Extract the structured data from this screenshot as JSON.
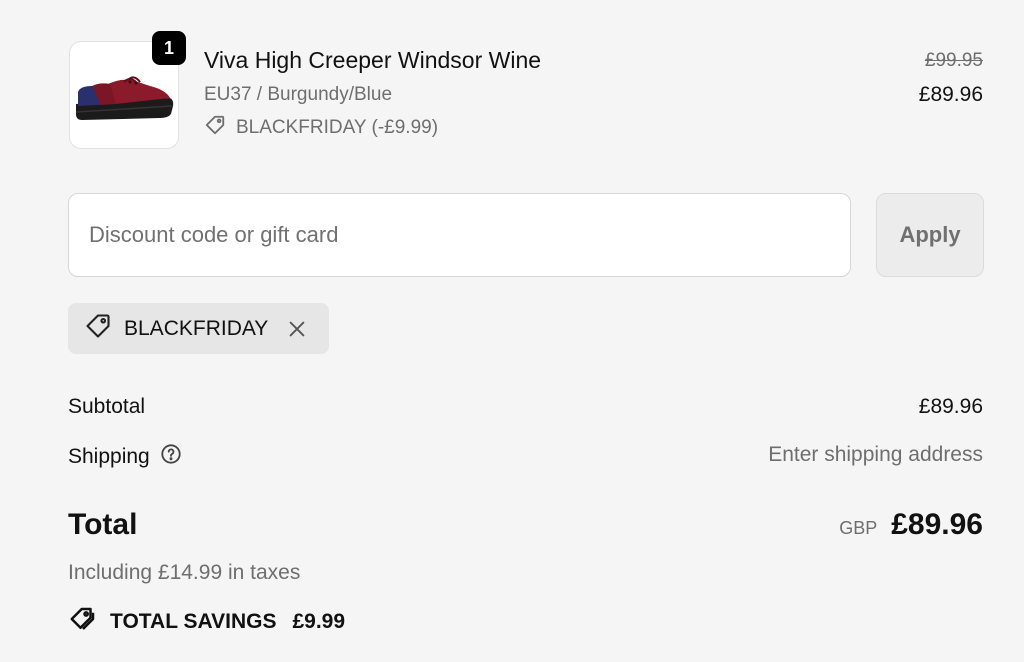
{
  "line_item": {
    "quantity": "1",
    "name": "Viva High Creeper Windsor Wine",
    "variant": "EU37 / Burgundy/Blue",
    "discount_applied": "BLACKFRIDAY (-£9.99)",
    "original_price": "£99.95",
    "price": "£89.96",
    "image_icon": "creeper-shoe-image"
  },
  "discount": {
    "placeholder": "Discount code or gift card",
    "value": "",
    "apply_label": "Apply",
    "applied_code": "BLACKFRIDAY"
  },
  "summary": {
    "subtotal_label": "Subtotal",
    "subtotal_value": "£89.96",
    "shipping_label": "Shipping",
    "shipping_value": "Enter shipping address",
    "total_label": "Total",
    "currency": "GBP",
    "total_value": "£89.96",
    "taxes_note": "Including £14.99 in taxes",
    "savings_label": "TOTAL SAVINGS",
    "savings_value": "£9.99"
  },
  "colors": {
    "background": "#f5f5f5",
    "muted_text": "#6e6e6e",
    "badge": "#000000",
    "chip": "#e6e6e6"
  }
}
